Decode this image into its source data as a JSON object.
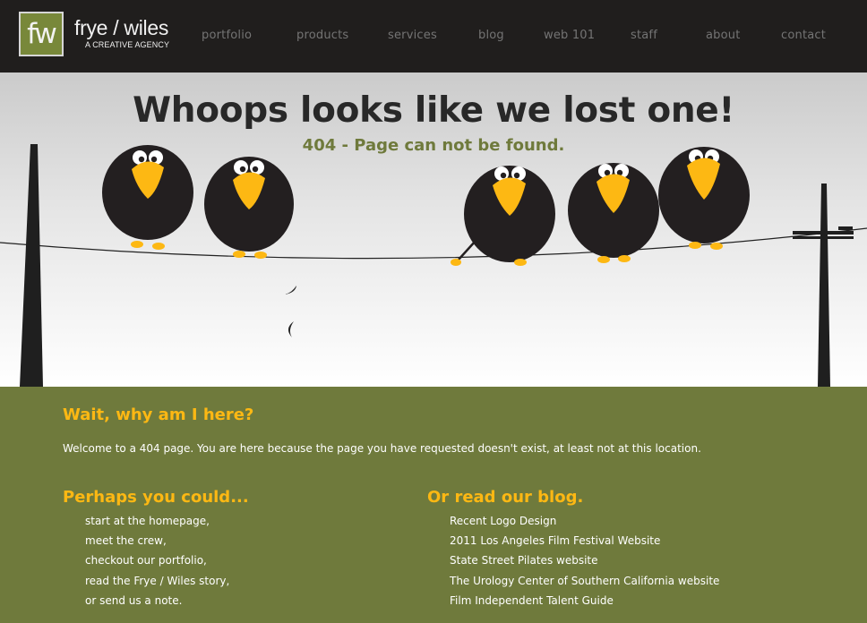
{
  "header": {
    "logo_mark": "fw",
    "brand_name": "frye / wiles",
    "tagline": "A CREATIVE AGENCY",
    "nav": [
      "portfolio",
      "products",
      "services",
      "blog",
      "web 101",
      "staff",
      "about",
      "contact"
    ]
  },
  "hero": {
    "title": "Whoops looks like we lost one!",
    "subtitle": "404 - Page can not be found."
  },
  "why": {
    "heading": "Wait, why am I here?",
    "text": "Welcome to a 404 page. You are here because the page you have requested doesn't exist, at least not at this location."
  },
  "could": {
    "heading": "Perhaps you could...",
    "items": [
      "start at the homepage,",
      "meet the crew,",
      "checkout our portfolio,",
      "read the Frye / Wiles story,",
      "or send us a note."
    ]
  },
  "blog": {
    "heading": "Or read our blog.",
    "items": [
      "Recent Logo Design",
      "2011 Los Angeles Film Festival Website",
      "State Street Pilates website",
      "The Urology Center of Southern California website",
      "Film Independent Talent Guide"
    ]
  },
  "colors": {
    "header_bg": "#201e1d",
    "accent_green": "#6f7a3c",
    "accent_yellow": "#fdb813",
    "bird_body": "#231f20",
    "beak": "#fdb813"
  },
  "icons": [
    "bird-icon",
    "utility-pole-icon",
    "falling-feather-icon"
  ]
}
